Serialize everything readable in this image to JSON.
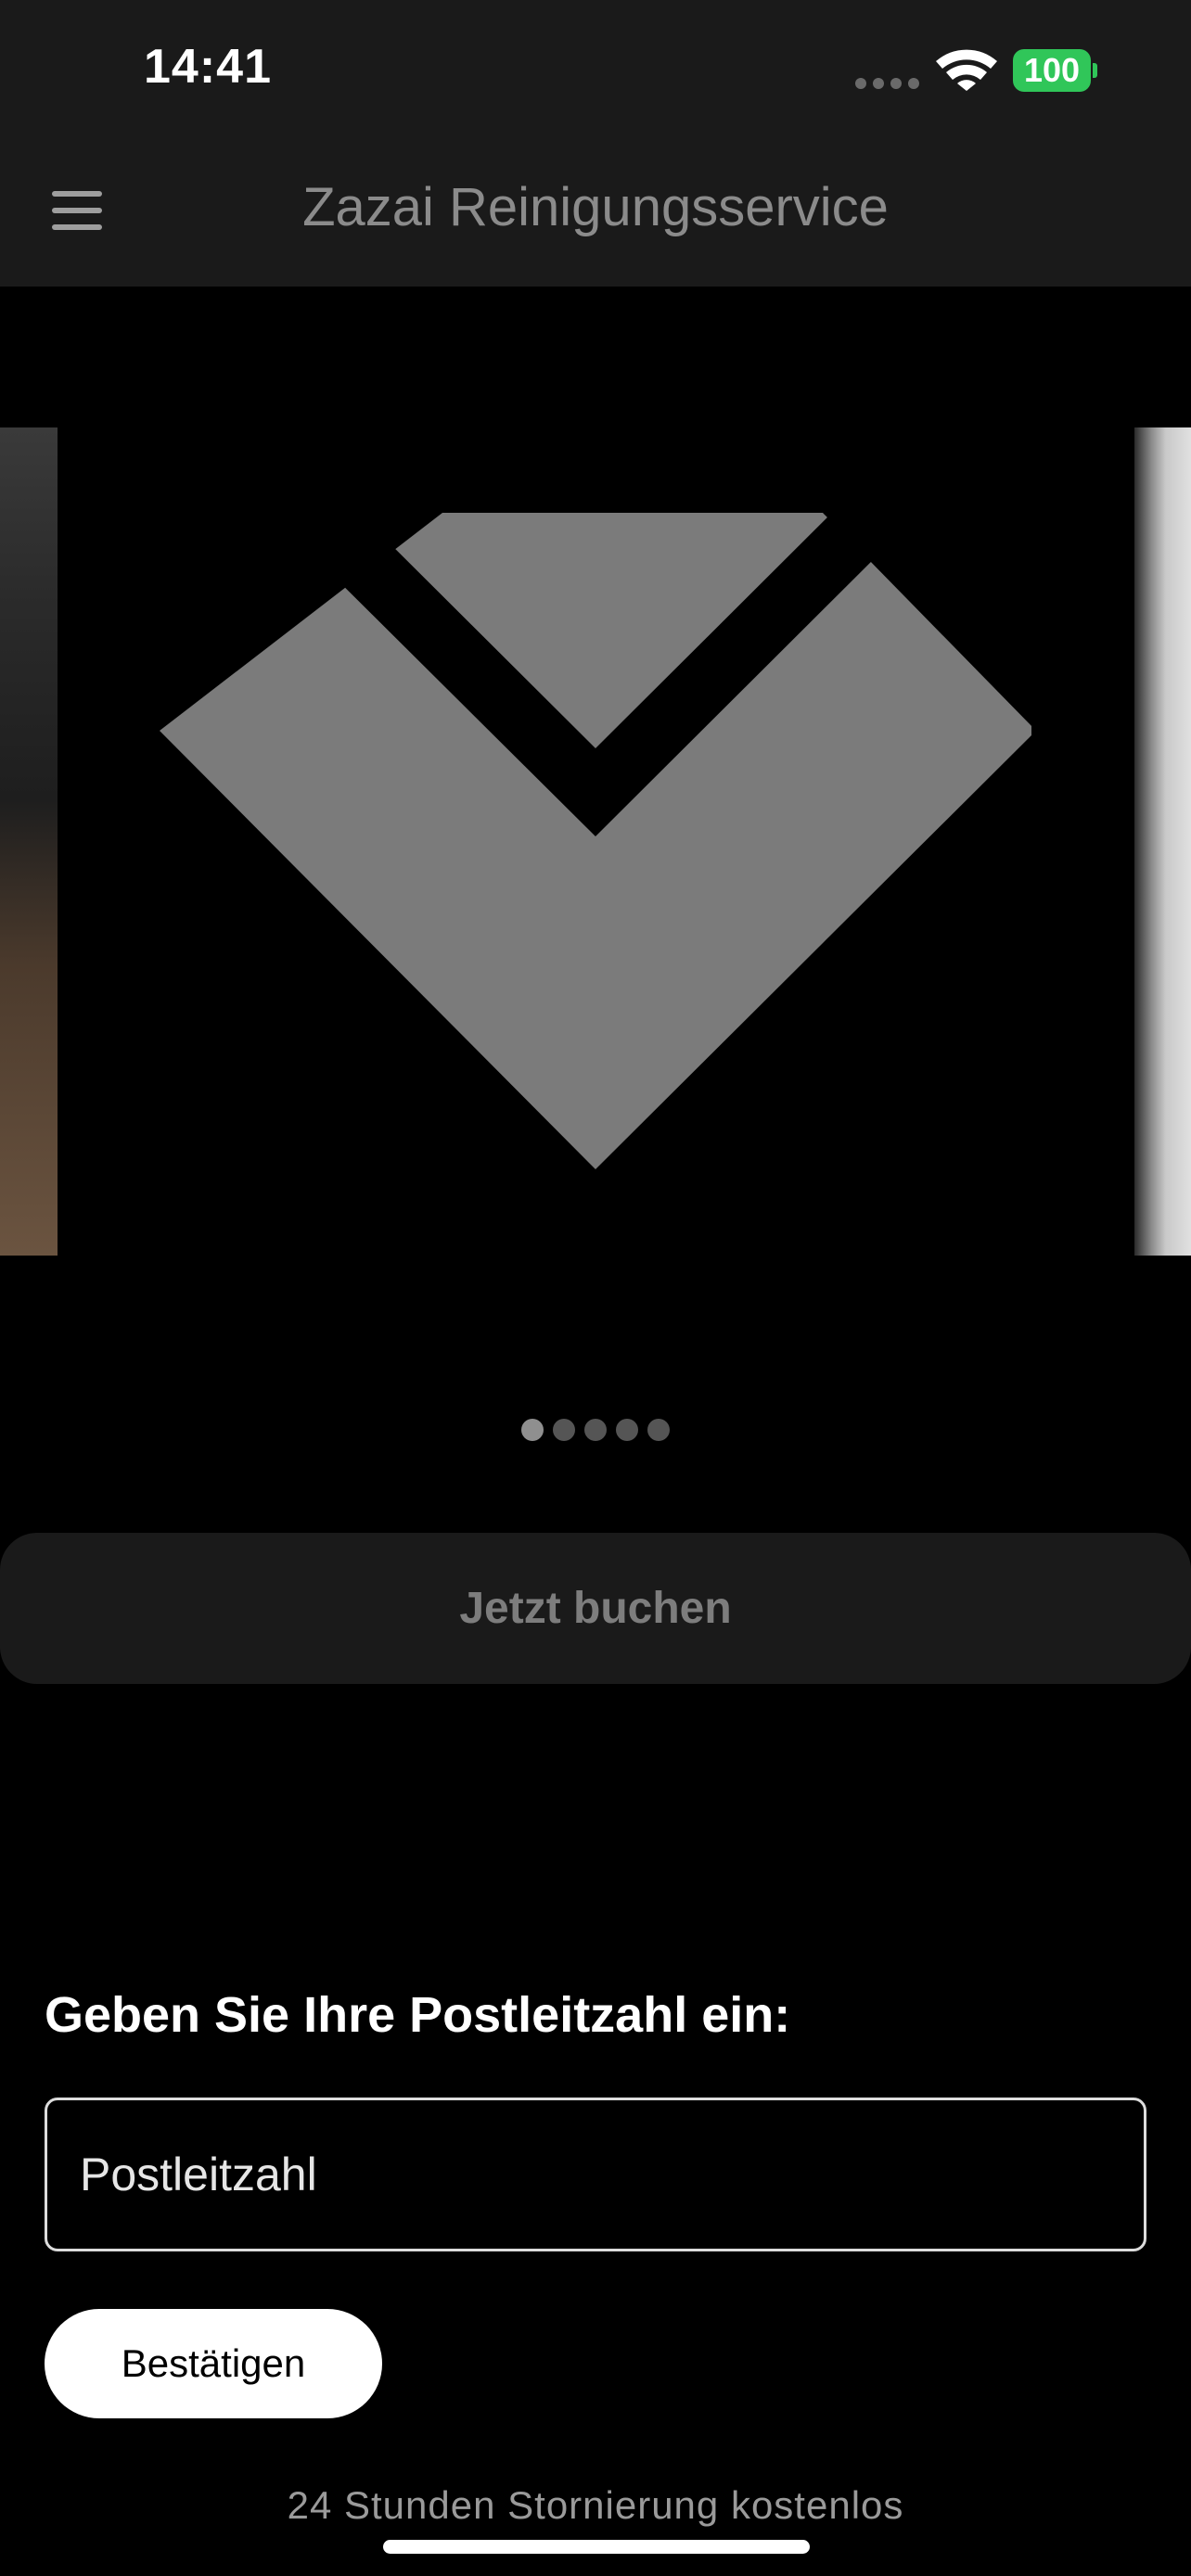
{
  "status_bar": {
    "time": "14:41",
    "battery_level": "100",
    "battery_color": "#30c659"
  },
  "nav": {
    "title": "Zazai Reinigungsservice",
    "menu_icon": "hamburger-menu-icon"
  },
  "carousel": {
    "slide_count": 5,
    "active_index": 0,
    "logo_color": "#7b7b7b"
  },
  "booking": {
    "book_label": "Jetzt buchen"
  },
  "zip": {
    "prompt": "Geben Sie Ihre Postleitzahl ein:",
    "placeholder": "Postleitzahl",
    "value": "",
    "confirm_label": "Bestätigen"
  },
  "footer": {
    "note": "24 Stunden Stornierung kostenlos"
  }
}
